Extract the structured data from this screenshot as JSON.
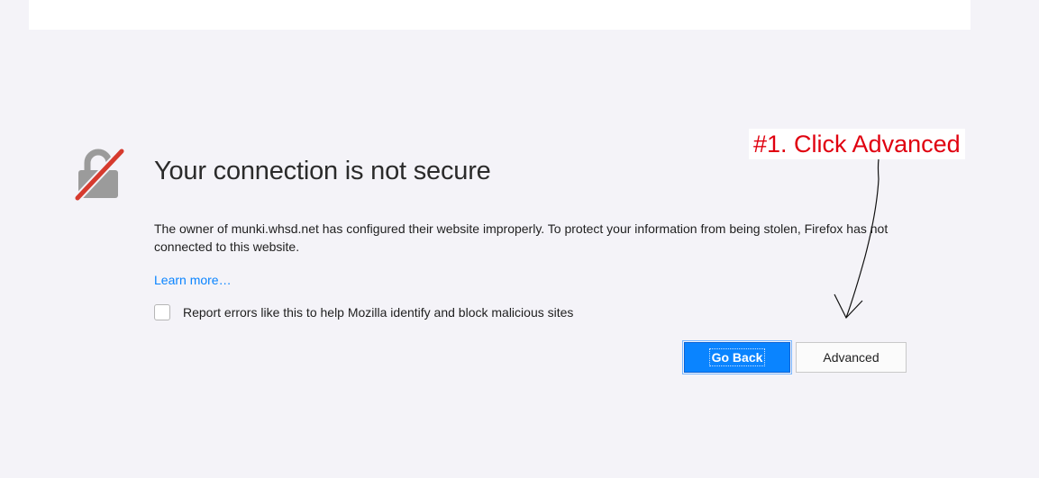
{
  "error_page": {
    "title": "Your connection is not secure",
    "description": "The owner of munki.whsd.net has configured their website improperly. To protect your information from being stolen, Firefox has not connected to this website.",
    "learn_more": "Learn more…",
    "report_label": "Report errors like this to help Mozilla identify and block malicious sites",
    "report_checked": false,
    "go_back_label": "Go Back",
    "advanced_label": "Advanced",
    "icon": "broken-lock-icon"
  },
  "annotation": {
    "text": "#1.  Click Advanced",
    "color": "#e0000f"
  },
  "colors": {
    "accent": "#0a84ff",
    "background": "#f4f3f8",
    "slash": "#d63a2e"
  }
}
